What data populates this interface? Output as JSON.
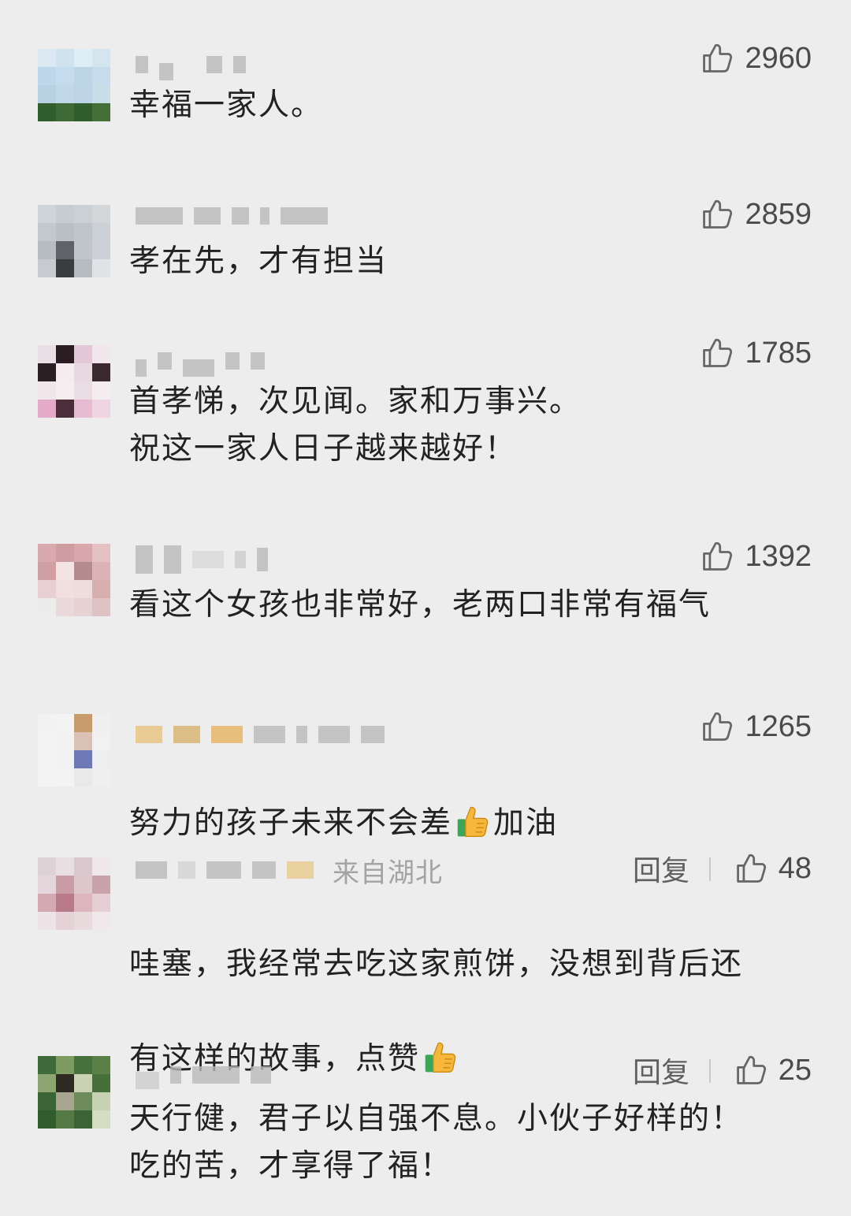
{
  "comments": [
    {
      "text": "幸福一家人。",
      "likes": "2960"
    },
    {
      "text": "孝在先，才有担当",
      "likes": "2859"
    },
    {
      "text": "首孝悌，次见闻。家和万事兴。\n祝这一家人日子越来越好！",
      "likes": "1785"
    },
    {
      "text": "看这个女孩也非常好，老两口非常有福气",
      "likes": "1392"
    },
    {
      "text_before": "努力的孩子未来不会差",
      "text_after": "加油",
      "likes": "1265"
    },
    {
      "location": "来自湖北",
      "reply": "回复",
      "text_line1": "哇塞，我经常去吃这家煎饼，没想到背后还",
      "text_line2": "有这样的故事，点赞",
      "likes": "48"
    },
    {
      "reply": "回复",
      "text": "天行健，君子以自强不息。小伙子好样的！\n吃的苦，才享得了福！",
      "likes": "25"
    }
  ],
  "icons": {
    "like": "thumbs-up-icon",
    "emoji": "thumbs-up-emoji"
  },
  "colors": {
    "background": "#ededed",
    "text": "#222222",
    "muted": "#a3a3a3"
  }
}
